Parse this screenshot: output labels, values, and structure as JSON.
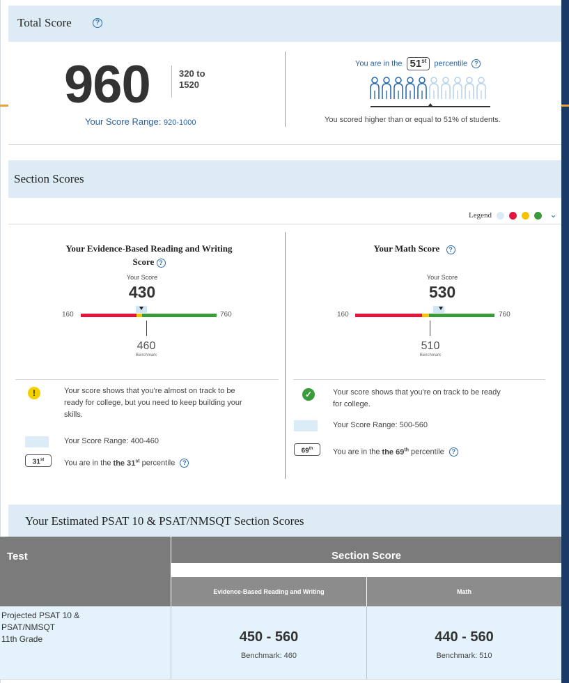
{
  "total": {
    "title": "Total Score",
    "score": "960",
    "range_min": "320 to",
    "range_max": "1520",
    "your_range_label": "Your Score Range:",
    "your_range_value": "920-1000",
    "percentile_prefix": "You are in the",
    "percentile_value": "51",
    "percentile_suffix_ordinal": "st",
    "percentile_suffix": "percentile",
    "percentile_fraction": 0.51,
    "percentile_foot": "You scored higher than or equal to 51% of students."
  },
  "section": {
    "title": "Section Scores",
    "legend_label": "Legend",
    "legend_colors": [
      "#dcecf7",
      "#e3173e",
      "#f5c400",
      "#3a9b3a"
    ],
    "ebrw": {
      "title_line1": "Your Evidence-Based Reading and Writing",
      "title_line2": "Score",
      "your_score_label": "Your Score",
      "score": "430",
      "scale_min": "160",
      "scale_max": "760",
      "benchmark": "460",
      "benchmark_label": "Benchmark",
      "status": "warning",
      "message_line1": "Your score shows that you're almost on track to be",
      "message_line2": "ready for college, but you need to keep building your",
      "message_line3": "skills.",
      "range_text": "Your Score Range: 400-460",
      "percentile_value": "31",
      "percentile_ordinal": "st",
      "percentile_prefix": "You are in the",
      "percentile_suffix": "percentile"
    },
    "math": {
      "title": "Your Math Score",
      "your_score_label": "Your Score",
      "score": "530",
      "scale_min": "160",
      "scale_max": "760",
      "benchmark": "510",
      "benchmark_label": "Benchmark",
      "status": "success",
      "message_line1": "Your score shows that you're on track to be ready",
      "message_line2": "for college.",
      "range_text": "Your Score Range: 500-560",
      "percentile_value": "69",
      "percentile_ordinal": "th",
      "percentile_prefix": "You are in the",
      "percentile_suffix": "percentile"
    }
  },
  "estimated": {
    "title": "Your Estimated PSAT 10 & PSAT/NMSQT Section Scores",
    "col_test": "Test",
    "col_section_score": "Section Score",
    "sub_ebrw": "Evidence-Based Reading and Writing",
    "sub_math": "Math",
    "row_label_line1": "Projected PSAT 10 &",
    "row_label_line2": "PSAT/NMSQT",
    "row_label_line3": "11th Grade",
    "ebrw_range": "450 - 560",
    "ebrw_benchmark": "Benchmark: 460",
    "math_range": "440 - 560",
    "math_benchmark": "Benchmark: 510"
  }
}
